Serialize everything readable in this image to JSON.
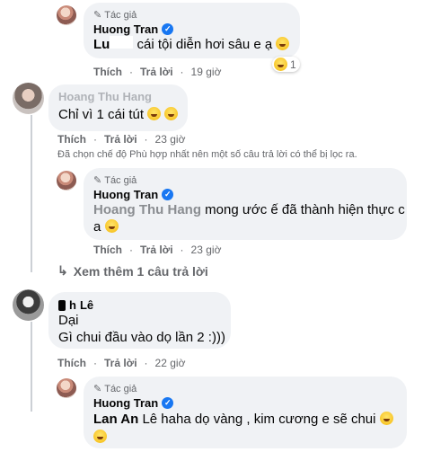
{
  "comments": [
    {
      "badge": "Tác giả",
      "name": "Huong Tran",
      "mention": "Lu",
      "text_tail": "cái tội diễn hơi sâu e ạ",
      "reaction_count": "1",
      "like": "Thích",
      "reply": "Trả lời",
      "time": "19 giờ"
    },
    {
      "name": "Hoang Thu Hang",
      "text": "Chỉ vì 1 cái tút",
      "like": "Thích",
      "reply": "Trả lời",
      "time": "23 giờ"
    },
    {
      "badge": "Tác giả",
      "name": "Huong Tran",
      "mention": "Hoang Thu Hang",
      "text_tail": "mong ước ế đã thành hiện thực c",
      "text_line2": "a",
      "like": "Thích",
      "reply": "Trả lời",
      "time": "23 giờ"
    },
    {
      "name": "Lê",
      "name_prefix": "h",
      "line1": "Dại",
      "line2": "Gì chui đầu vào dọ lần 2 :)))",
      "like": "Thích",
      "reply": "Trả lời",
      "time": "22 giờ"
    },
    {
      "badge": "Tác giả",
      "name": "Huong Tran",
      "mention": "Lan An",
      "text_tail": "Lê haha dọ vàng , kim cương e sẽ chui"
    }
  ],
  "filter_notice": "Đã chọn chế độ Phù hợp nhất nên một số câu trả lời có thể bị lọc ra.",
  "more_replies": "Xem thêm 1 câu trả lời",
  "separator": "·",
  "icons": {
    "pencil": "pencil-icon",
    "verified": "verified-icon",
    "reply_arrow": "reply-arrow-icon",
    "emoji": "laughing-emoji-icon"
  },
  "colors": {
    "bubble": "#f0f2f5",
    "meta": "#65676b",
    "verified": "#1877f2"
  }
}
